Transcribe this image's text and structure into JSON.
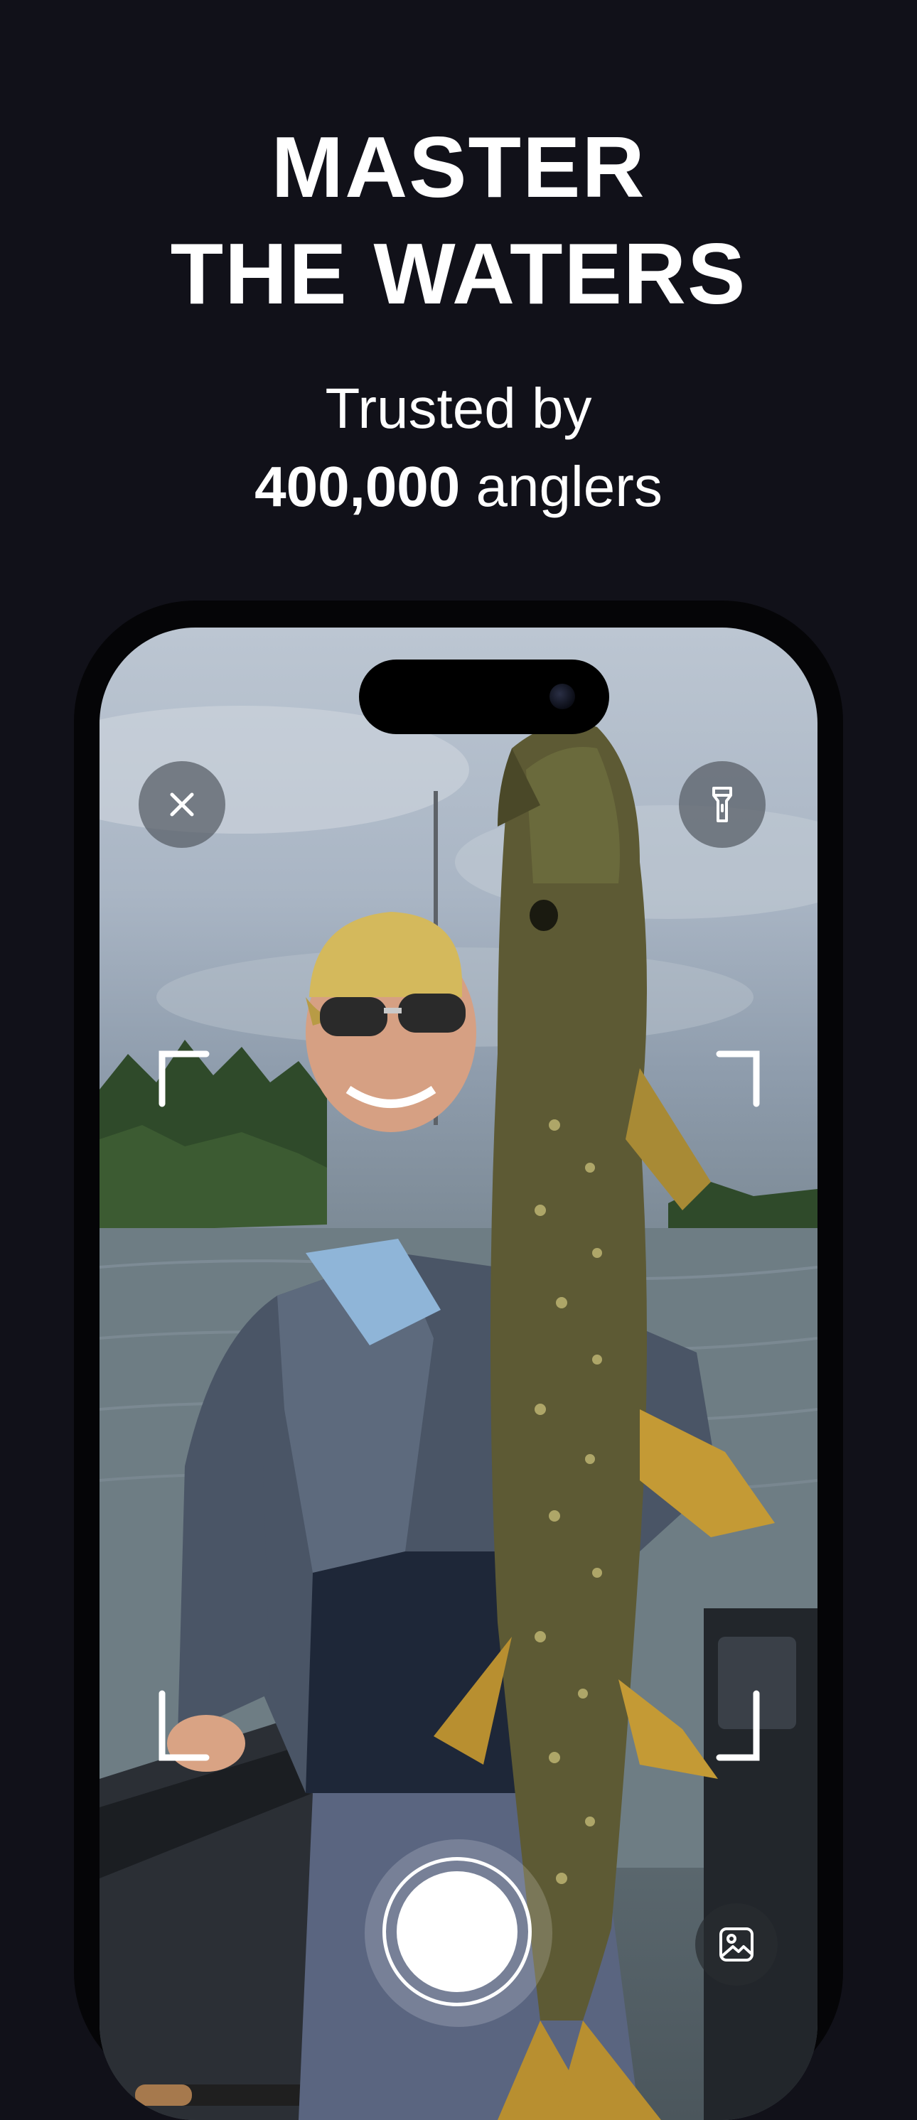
{
  "headline": {
    "line1": "MASTER",
    "line2": "THE WATERS"
  },
  "subtitle": {
    "line1": "Trusted by",
    "count": "400,000",
    "suffix": " anglers"
  },
  "camera": {
    "close_icon": "close-icon",
    "flash_icon": "flashlight-icon",
    "gallery_icon": "gallery-icon",
    "shutter_icon": "shutter-button"
  },
  "colors": {
    "background": "#111119",
    "text": "#ffffff",
    "overlay_button": "#5a6068"
  }
}
